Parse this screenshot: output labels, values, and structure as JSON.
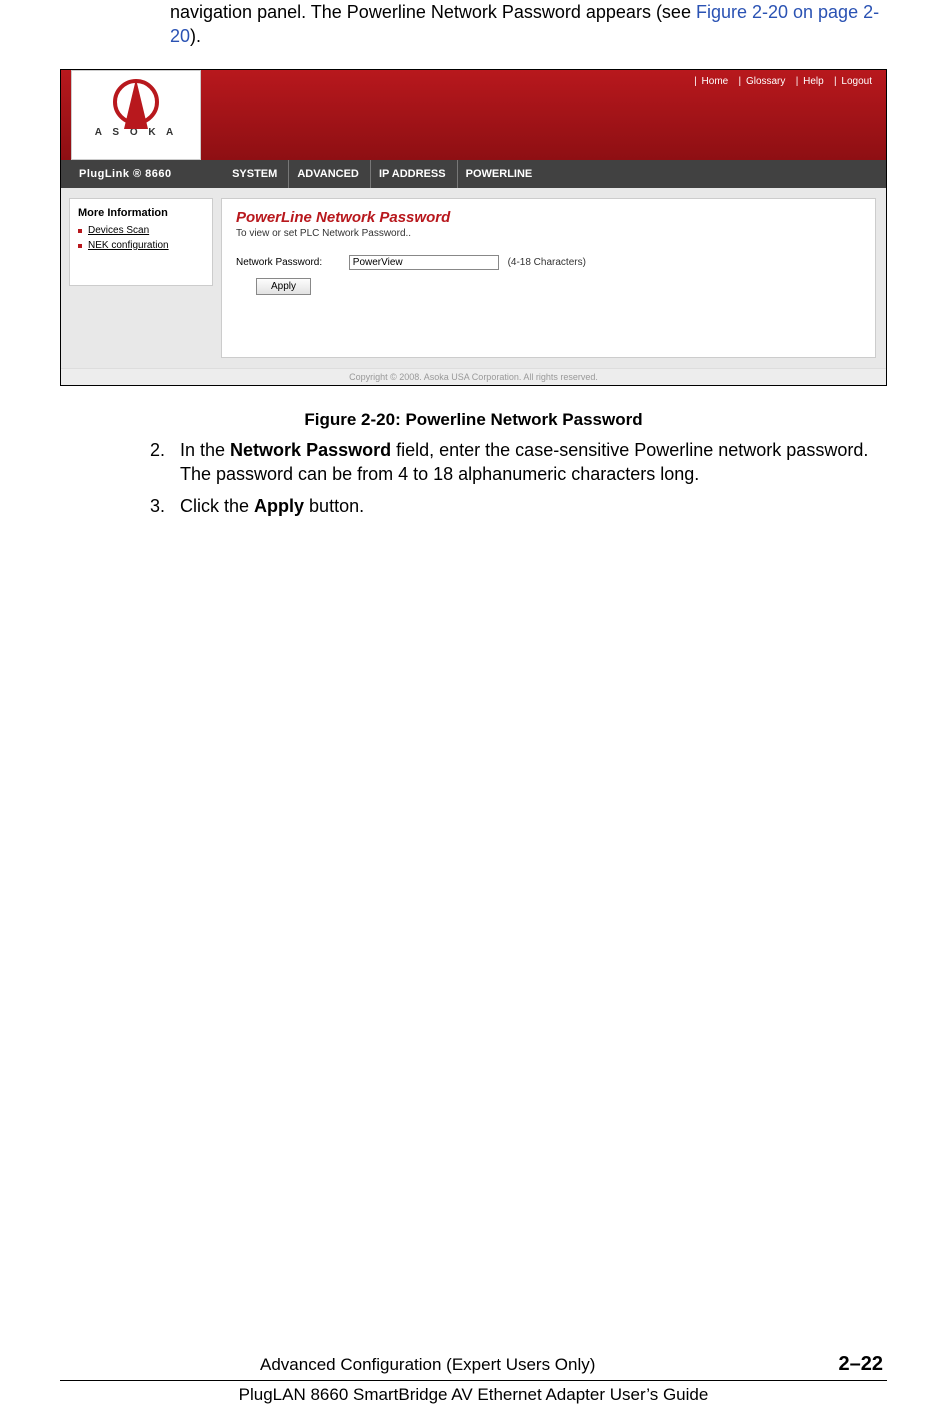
{
  "intro": {
    "pre": "navigation panel. The Powerline Network Password appears (see ",
    "link": "Figure 2-20 on page 2-20",
    "post": ")."
  },
  "ui": {
    "brand": "A S O K A",
    "topnav": {
      "home": "Home",
      "glossary": "Glossary",
      "help": "Help",
      "logout": "Logout"
    },
    "product": "PlugLink ®  8660",
    "tabs": {
      "system": "SYSTEM",
      "advanced": "ADVANCED",
      "ip": "IP ADDRESS",
      "powerline": "POWERLINE"
    },
    "sidebar": {
      "title": "More Information",
      "items": [
        "Devices Scan",
        "NEK configuration"
      ]
    },
    "main": {
      "title": "PowerLine Network Password",
      "subtitle": "To view or set PLC Network Password..",
      "field_label": "Network Password:",
      "field_value": "PowerView",
      "hint": "(4-18 Characters)",
      "apply": "Apply"
    },
    "copyright": "Copyright © 2008. Asoka USA Corporation. All rights reserved."
  },
  "caption": "Figure 2-20:  Powerline Network Password",
  "steps": {
    "s2": {
      "num": "2.",
      "a": "In the ",
      "b1": "Network Password",
      "c": " field, enter the case-sensitive Powerline network password. The password can be from 4 to 18 alphanumeric characters long."
    },
    "s3": {
      "num": "3.",
      "a": "Click the ",
      "b1": "Apply",
      "c": " button."
    }
  },
  "footer": {
    "section": "Advanced Configuration (Expert Users Only)",
    "page": "2–22",
    "guide": "PlugLAN 8660 SmartBridge AV Ethernet Adapter User’s Guide"
  }
}
